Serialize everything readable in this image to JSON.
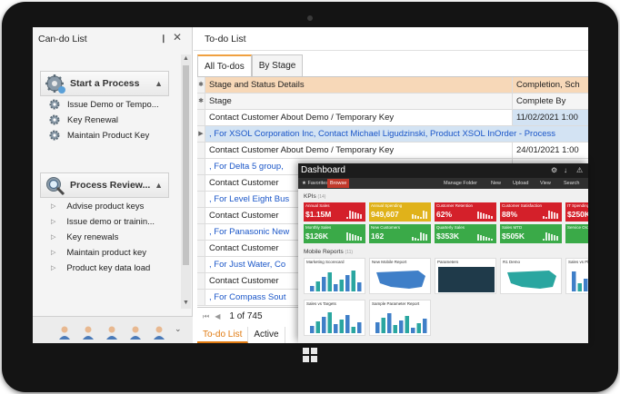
{
  "left_pane": {
    "title": "Can-do List",
    "pin_glyph": "❙",
    "close_glyph": "✕",
    "groups": [
      {
        "title": "Start a Process",
        "icon": "gear-icon",
        "items": [
          "Issue Demo or Tempo...",
          "Key Renewal",
          "Maintain Product Key"
        ]
      },
      {
        "title": "Process Review...",
        "icon": "magnifier-gear-icon",
        "items": [
          "Advise product keys",
          "Issue demo or trainin...",
          "Key renewals",
          "Maintain product key",
          "Product key data load"
        ]
      }
    ],
    "grip": "......",
    "users_count": 5
  },
  "right_pane": {
    "title": "To-do List",
    "tabs": [
      "All To-dos",
      "By Stage"
    ],
    "grid": {
      "header_row1": [
        "Stage and Status Details",
        "Completion, Sch"
      ],
      "header_row2": [
        "Stage",
        "Complete By"
      ],
      "rows": [
        {
          "text": "Contact Customer About Demo / Temporary Key",
          "date": "11/02/2021 1:00",
          "style": "normal"
        },
        {
          "text": ", For XSOL Corporation Inc, Contact Michael Ligudzinski, Product XSOL InOrder - Process",
          "date": "",
          "style": "selected"
        },
        {
          "text": "Contact Customer About Demo / Temporary Key",
          "date": "24/01/2021 1:00",
          "style": "normal"
        },
        {
          "text": ", For Delta 5 group,",
          "date": "",
          "style": "blue"
        },
        {
          "text": "Contact Customer",
          "date": "",
          "style": "normal"
        },
        {
          "text": ", For Level Eight Bus",
          "date": "",
          "style": "blue"
        },
        {
          "text": "Contact Customer",
          "date": "",
          "style": "normal"
        },
        {
          "text": ", For Panasonic New",
          "date": "",
          "style": "blue"
        },
        {
          "text": "Contact Customer",
          "date": "",
          "style": "normal"
        },
        {
          "text": ", For Just Water, Co",
          "date": "",
          "style": "blue"
        },
        {
          "text": "Contact Customer",
          "date": "",
          "style": "normal"
        },
        {
          "text": ", For Compass Sout",
          "date": "",
          "style": "blue"
        }
      ]
    },
    "pager": {
      "first": "⏮",
      "prev": "◀",
      "page_text": "1 of 745"
    },
    "bottom_tabs": [
      "To-do List",
      "Active"
    ]
  },
  "dashboard": {
    "title": "Dashboard",
    "bar_favorites": "★ Favorites",
    "bar_browse": "Browse",
    "bar_right": [
      "Manage Folder",
      "New",
      "Upload",
      "View",
      "Search"
    ],
    "kpis_label": "KPIs",
    "kpis_count": "(14)",
    "kpis": [
      {
        "label": "Annual Sales",
        "value": "$1.15M",
        "color": "#d4202a"
      },
      {
        "label": "Annual Spending",
        "value": "949,607",
        "color": "#e0b21a"
      },
      {
        "label": "Customer Retention",
        "value": "62%",
        "color": "#d4202a"
      },
      {
        "label": "Customer Satisfaction",
        "value": "88%",
        "color": "#d4202a"
      },
      {
        "label": "IT Spending",
        "value": "$250K",
        "color": "#d4202a"
      },
      {
        "label": "Monthly Sales",
        "value": "$126K",
        "color": "#3aaa48"
      },
      {
        "label": "New Customers",
        "value": "162",
        "color": "#3aaa48"
      },
      {
        "label": "Quarterly Sales",
        "value": "$353K",
        "color": "#3aaa48"
      },
      {
        "label": "Sales MTD",
        "value": "$505K",
        "color": "#3aaa48"
      },
      {
        "label": "Service Order",
        "value": "",
        "color": "#3aaa48"
      }
    ],
    "mobile_label": "Mobile Reports",
    "mobile_count": "(11)",
    "reports": [
      {
        "label": "Marketing Scorecard"
      },
      {
        "label": "New Mobile Report"
      },
      {
        "label": "Parameters"
      },
      {
        "label": "R1 Demo"
      },
      {
        "label": "Sales vs Pl..."
      },
      {
        "label": "Sales vs Targets"
      },
      {
        "label": "Sample Parameter Report"
      }
    ]
  },
  "colors": {
    "accent_orange": "#e07a10",
    "link_blue": "#1a56c8",
    "header_peach": "#f7d8b8"
  }
}
